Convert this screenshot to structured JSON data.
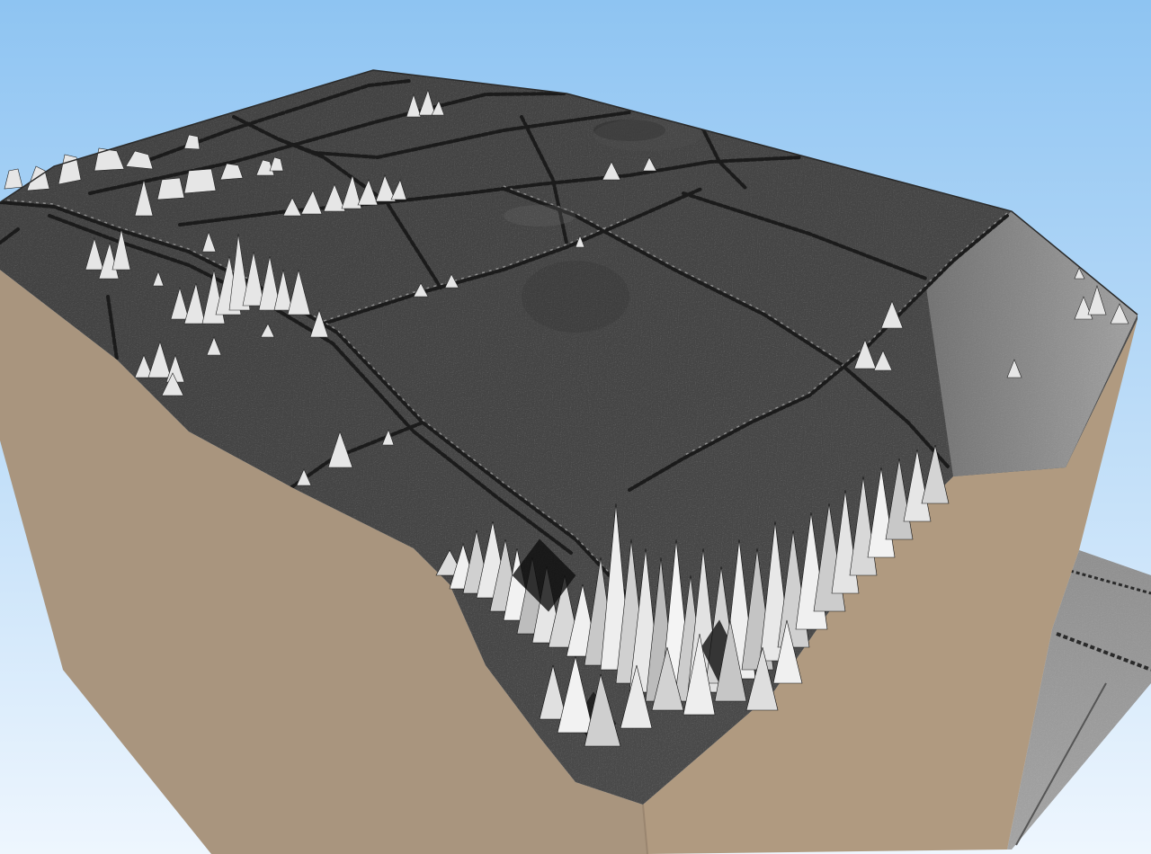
{
  "scene": {
    "kind": "3d-terrain-block",
    "colors": {
      "sky_top": "#8ec4f2",
      "sky_bottom": "#eef6fe",
      "block_side_left": "#a9957e",
      "block_side_right": "#b19a80",
      "terrain_dark": "#3a3a3a",
      "terrain_mid": "#555555",
      "terrain_light": "#dcdcdc",
      "hedge_line": "#1a1a1a"
    }
  }
}
